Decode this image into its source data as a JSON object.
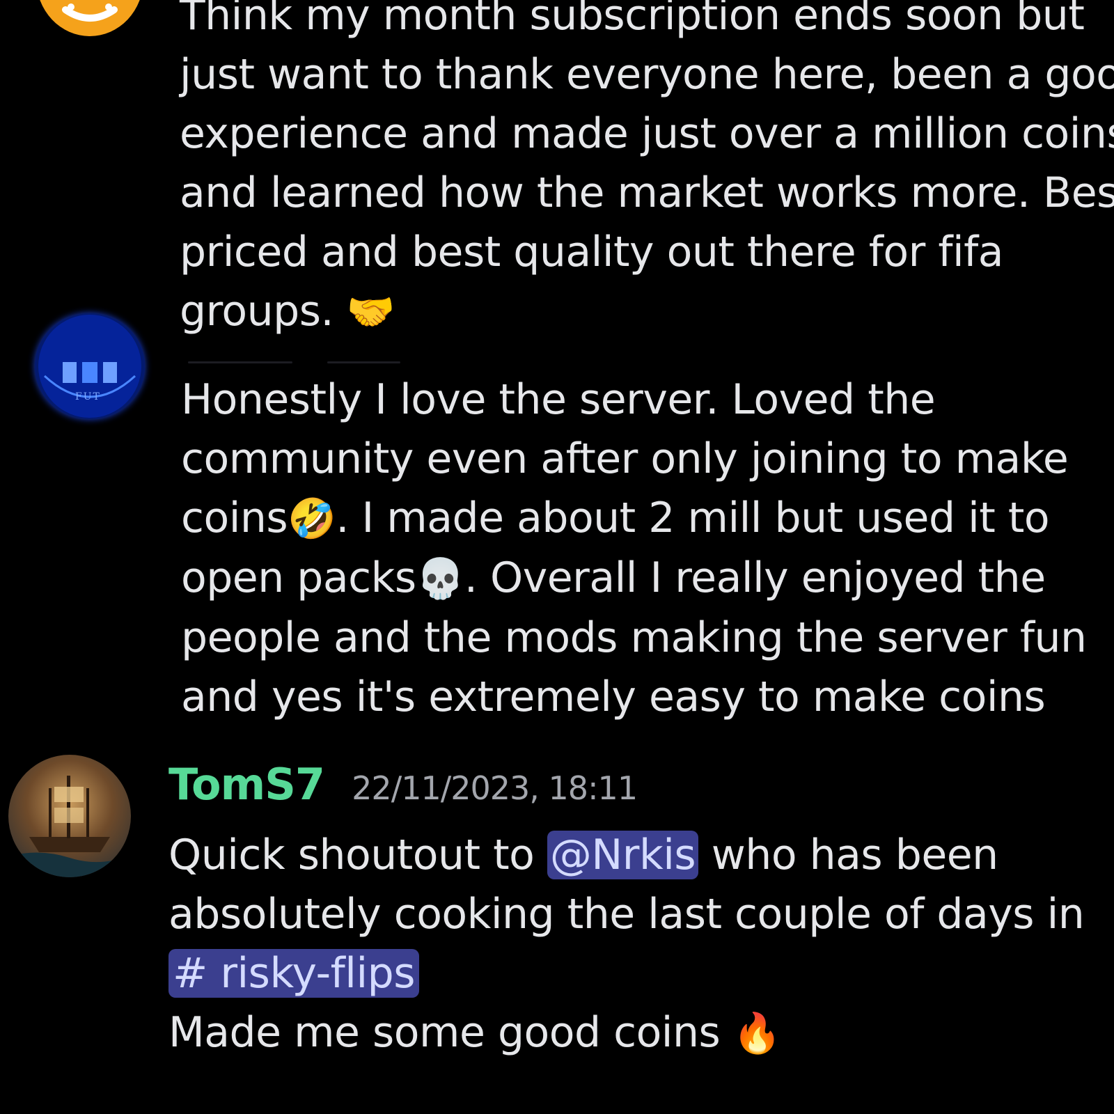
{
  "messages": [
    {
      "lines": [
        "Think my month subscription ends soon but",
        "just want to thank everyone here, been a good",
        "experience and made just over a million coins",
        "and learned how the market works more. Best",
        "priced and best quality out there for fifa",
        "groups."
      ],
      "emoji_end": "🤝"
    },
    {
      "avatar_text": "FUT",
      "line1": "Honestly I love the server. Loved the",
      "line2": "community even after only joining to make",
      "line3_a": "coins",
      "line3_emoji": "🤣",
      "line3_b": ". I made about 2 mill but used it to",
      "line4_a": "open packs",
      "line4_emoji": "💀",
      "line4_b": ". Overall I really enjoyed the",
      "line5": "people and the mods making the server fun",
      "line6": "and yes it's extremely easy to make coins"
    },
    {
      "username": "TomS7",
      "timestamp": "22/11/2023, 18:11",
      "line1_a": "Quick shoutout to ",
      "mention": "@Nrkis",
      "line1_b": " who has been",
      "line2": "absolutely cooking the last couple of days in",
      "channel": "# risky-flips",
      "line4": "Made me some good coins ",
      "line4_emoji": "🔥"
    }
  ],
  "colors": {
    "background": "#000000",
    "username": "#57d997",
    "mention_bg": "#3b3f8f",
    "avatar_orange": "#f5a21b",
    "avatar_blue": "#0a2a9a"
  },
  "icons": {
    "avatar1": "orange-avatar",
    "avatar2": "fut-badge-avatar",
    "avatar3": "pirate-ship-avatar"
  }
}
